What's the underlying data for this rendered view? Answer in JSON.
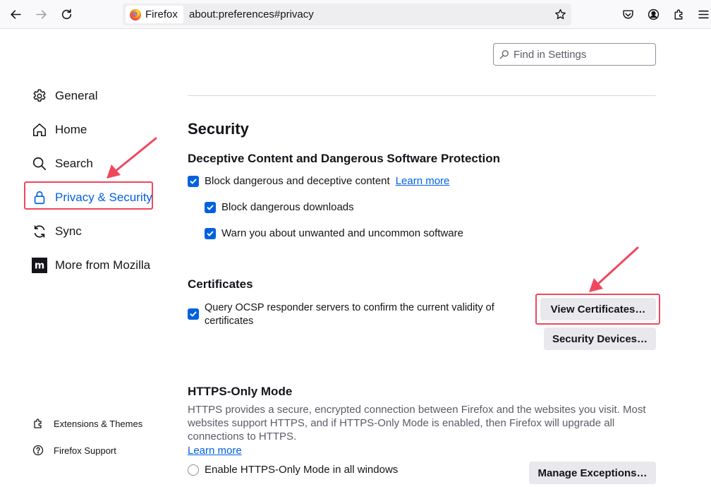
{
  "toolbar": {
    "identity_label": "Firefox",
    "url": "about:preferences#privacy",
    "icons": [
      "back-icon",
      "forward-icon",
      "reload-icon",
      "bookmark-star-icon",
      "pocket-icon",
      "account-icon",
      "extensions-icon",
      "menu-icon"
    ]
  },
  "search": {
    "placeholder": "Find in Settings"
  },
  "sidebar": {
    "items": [
      {
        "label": "General",
        "icon": "gear-icon"
      },
      {
        "label": "Home",
        "icon": "home-icon"
      },
      {
        "label": "Search",
        "icon": "search-icon"
      },
      {
        "label": "Privacy & Security",
        "icon": "lock-icon",
        "selected": true
      },
      {
        "label": "Sync",
        "icon": "sync-icon"
      },
      {
        "label": "More from Mozilla",
        "icon": "mozilla-icon"
      }
    ],
    "footer": [
      {
        "label": "Extensions & Themes",
        "icon": "puzzle-icon"
      },
      {
        "label": "Firefox Support",
        "icon": "help-icon"
      }
    ]
  },
  "main": {
    "section_title": "Security",
    "deceptive": {
      "title": "Deceptive Content and Dangerous Software Protection",
      "block_label": "Block dangerous and deceptive content",
      "learn_more": "Learn more",
      "downloads_label": "Block dangerous downloads",
      "warn_label": "Warn you about unwanted and uncommon software"
    },
    "certificates": {
      "title": "Certificates",
      "ocsp_line1": "Query OCSP responder servers to confirm the current validity of",
      "ocsp_line2": "certificates",
      "view_button": "View Certificates…",
      "devices_button": "Security Devices…"
    },
    "https_only": {
      "title": "HTTPS-Only Mode",
      "description": "HTTPS provides a secure, encrypted connection between Firefox and the websites you visit. Most websites support HTTPS, and if HTTPS-Only Mode is enabled, then Firefox will upgrade all connections to HTTPS.",
      "learn_more": "Learn more",
      "enable_all_label": "Enable HTTPS-Only Mode in all windows",
      "manage_button": "Manage Exceptions…"
    }
  },
  "colors": {
    "accent": "#0061e0",
    "annotation": "#f0475f"
  }
}
